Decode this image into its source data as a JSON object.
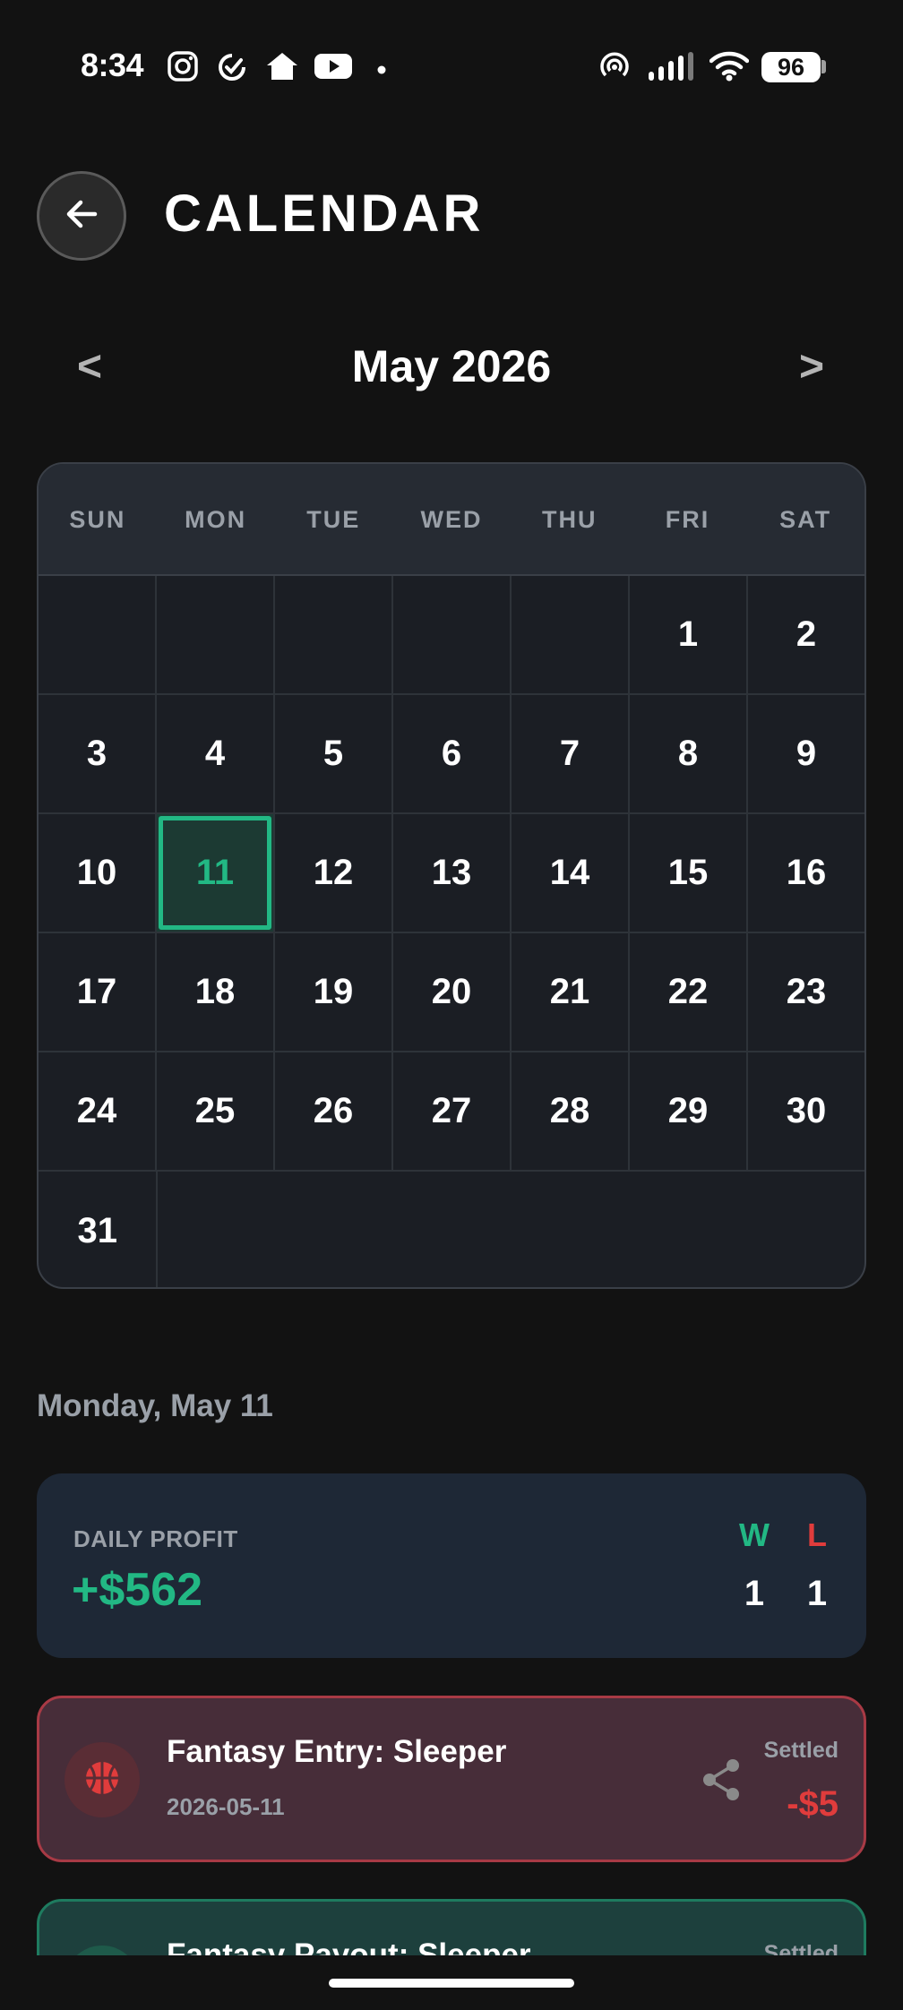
{
  "status_bar": {
    "time": "8:34",
    "icons": [
      "instagram-icon",
      "sync-icon",
      "home-icon",
      "youtube-icon",
      "dot-icon",
      "hotspot-icon",
      "signal-icon",
      "wifi-icon"
    ],
    "battery": "96"
  },
  "header": {
    "back_icon": "arrow-left-icon",
    "title": "CALENDAR"
  },
  "month_nav": {
    "prev": "<",
    "label": "May 2026",
    "next": ">"
  },
  "calendar": {
    "weekdays": [
      "SUN",
      "MON",
      "TUE",
      "WED",
      "THU",
      "FRI",
      "SAT"
    ],
    "weeks": [
      [
        "",
        "",
        "",
        "",
        "",
        "1",
        "2"
      ],
      [
        "3",
        "4",
        "5",
        "6",
        "7",
        "8",
        "9"
      ],
      [
        "10",
        "11",
        "12",
        "13",
        "14",
        "15",
        "16"
      ],
      [
        "17",
        "18",
        "19",
        "20",
        "21",
        "22",
        "23"
      ],
      [
        "24",
        "25",
        "26",
        "27",
        "28",
        "29",
        "30"
      ],
      [
        "31"
      ]
    ],
    "today": "11",
    "accent_color": "#22b884"
  },
  "selected_date": "Monday, May 11",
  "daily_profit": {
    "label": "DAILY PROFIT",
    "value": "+$562",
    "wins_label": "W",
    "wins": "1",
    "losses_label": "L",
    "losses": "1"
  },
  "transactions": [
    {
      "title": "Fantasy Entry: Sleeper",
      "date": "2026-05-11",
      "status": "Settled",
      "amount": "-$5",
      "icon": "basketball-icon",
      "share_icon": "share-icon",
      "tone": "loss"
    },
    {
      "title": "Fantasy Payout: Sleeper",
      "status": "Settled",
      "tone": "win"
    }
  ],
  "colors": {
    "win": "#22b884",
    "loss": "#e03c3c",
    "background": "#121212"
  }
}
